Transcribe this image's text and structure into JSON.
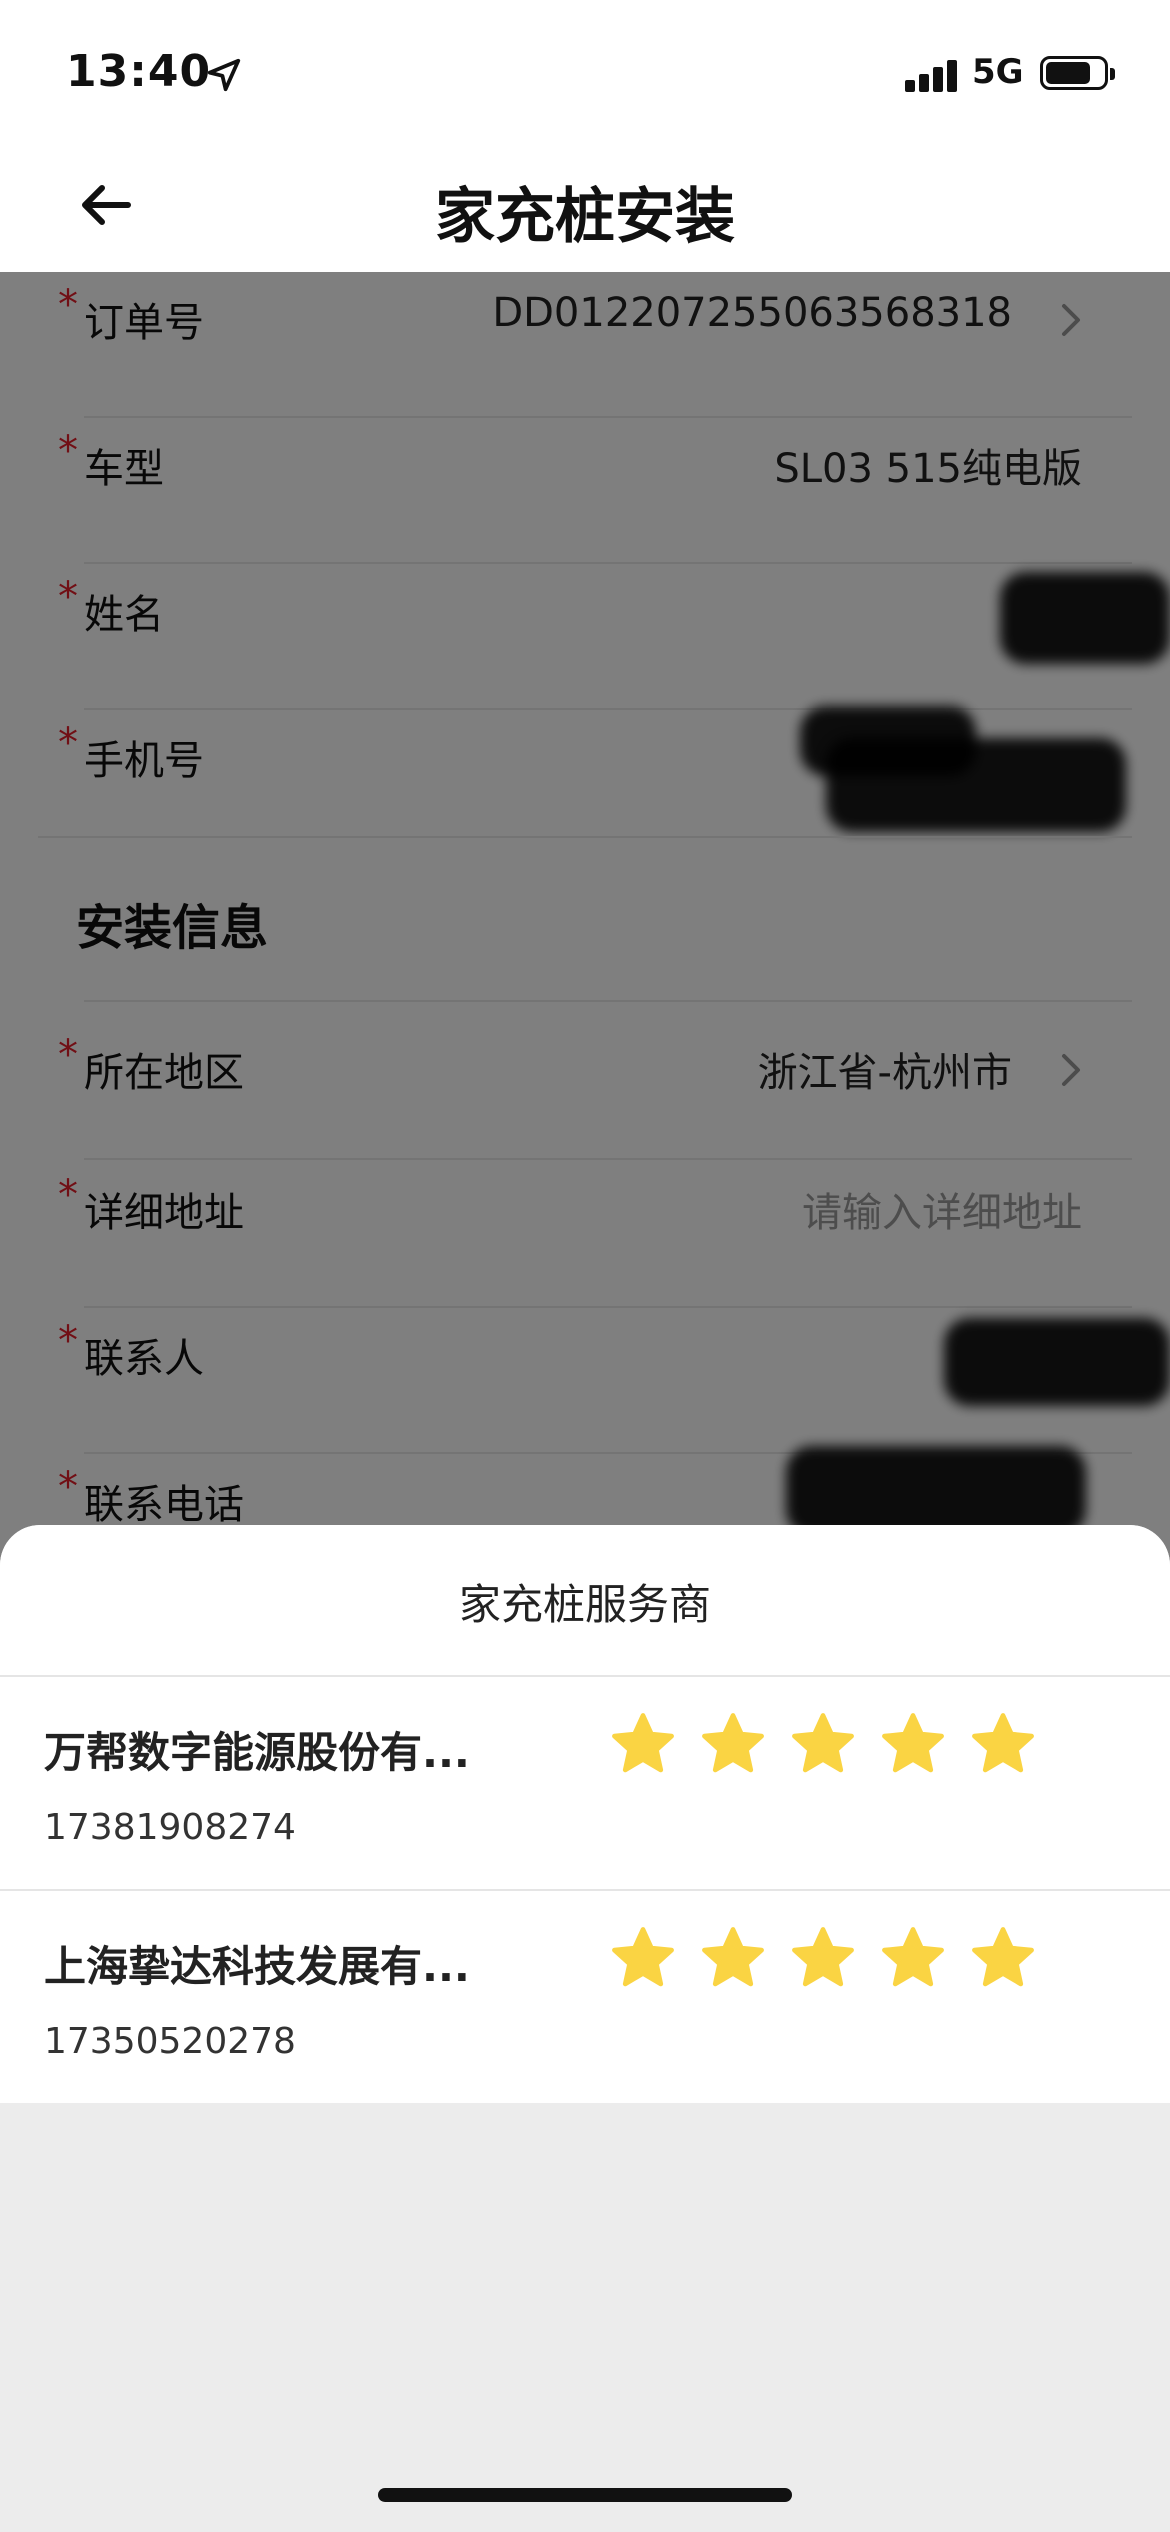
{
  "status_bar": {
    "time": "13:40",
    "network": "5G",
    "icons": [
      "location-arrow-icon",
      "signal-icon",
      "battery-icon"
    ]
  },
  "nav": {
    "title": "家充桩安装",
    "back_icon": "back-arrow-icon"
  },
  "form": {
    "order_fields": [
      {
        "label": "订单号",
        "value": "DD012207255063568318",
        "has_chevron": true
      },
      {
        "label": "车型",
        "value": "SL03 515纯电版",
        "has_chevron": false
      },
      {
        "label": "姓名",
        "value": "",
        "has_chevron": false,
        "redacted": true
      },
      {
        "label": "手机号",
        "value": "",
        "has_chevron": false,
        "redacted": true
      }
    ],
    "install_section_title": "安装信息",
    "install_fields": [
      {
        "label": "所在地区",
        "value": "浙江省-杭州市",
        "has_chevron": true
      },
      {
        "label": "详细地址",
        "placeholder": "请输入详细地址",
        "has_chevron": false
      },
      {
        "label": "联系人",
        "value": "",
        "has_chevron": false,
        "redacted": true
      },
      {
        "label": "联系电话",
        "value": "",
        "has_chevron": false,
        "redacted": true
      }
    ],
    "required_mark": "*"
  },
  "sheet": {
    "title": "家充桩服务商",
    "providers": [
      {
        "name": "万帮数字能源股份有...",
        "phone": "17381908274",
        "rating": 5
      },
      {
        "name": "上海挚达科技发展有...",
        "phone": "17350520278",
        "rating": 5
      }
    ],
    "star_color": "#FAD443"
  },
  "colors": {
    "required": "#E21E2A",
    "overlay": "rgba(0,0,0,0.5)"
  }
}
